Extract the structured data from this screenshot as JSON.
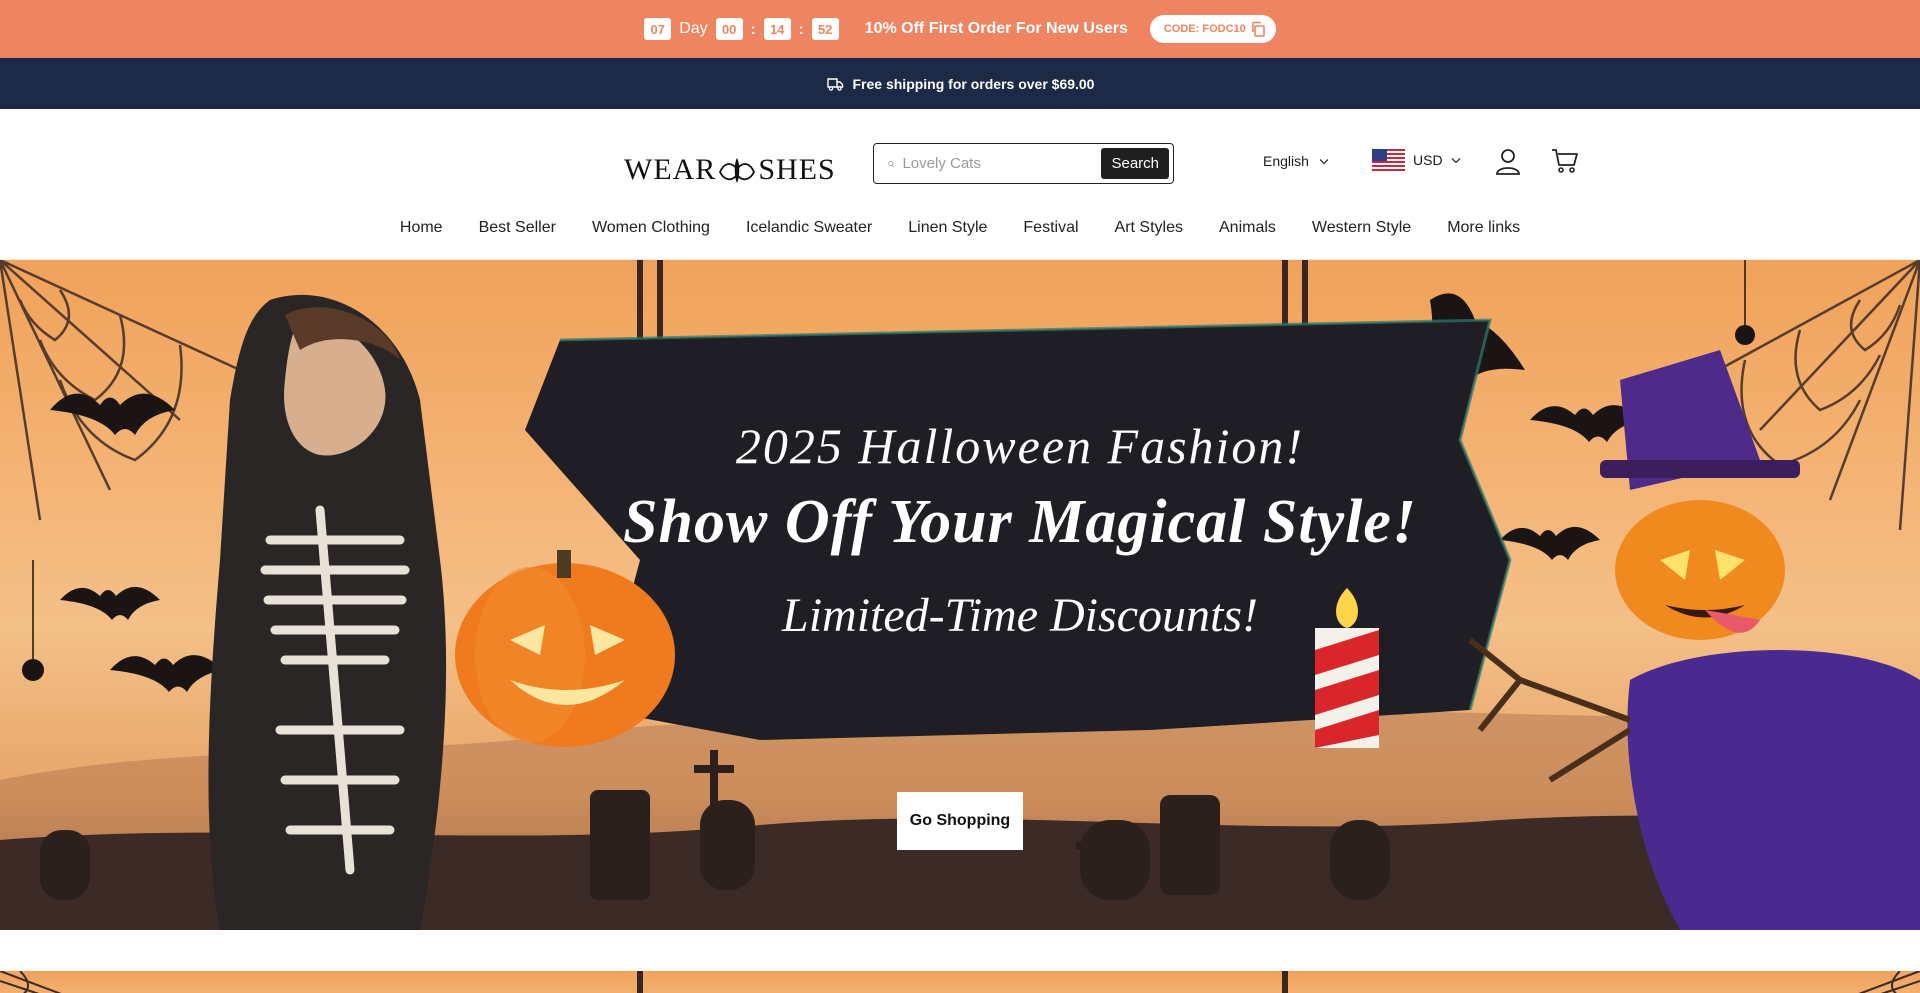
{
  "promo": {
    "countdown": {
      "days": "07",
      "day_label": "Day",
      "hours": "00",
      "minutes": "14",
      "seconds": "52",
      "sep": ":"
    },
    "message": "10% Off First Order For New Users",
    "code_label": "CODE: FODC10"
  },
  "shipping": {
    "text": "Free shipping for orders over $69.00"
  },
  "header": {
    "logo_left": "WEAR",
    "logo_right": "SHES",
    "search_placeholder": "Lovely Cats",
    "search_button": "Search",
    "language": "English",
    "currency": "USD"
  },
  "nav": {
    "items": [
      "Home",
      "Best Seller",
      "Women Clothing",
      "Icelandic Sweater",
      "Linen Style",
      "Festival",
      "Art Styles",
      "Animals",
      "Western Style",
      "More links"
    ]
  },
  "hero": {
    "line1": "2025 Halloween Fashion!",
    "line2": "Show Off Your Magical Style!",
    "line3": "Limited-Time Discounts!",
    "cta": "Go Shopping"
  },
  "colors": {
    "promo_bg": "#ef8460",
    "shipbar_bg": "#1c2947",
    "hero_orange": "#f0a25a",
    "sign_dark": "#1e1e24"
  }
}
